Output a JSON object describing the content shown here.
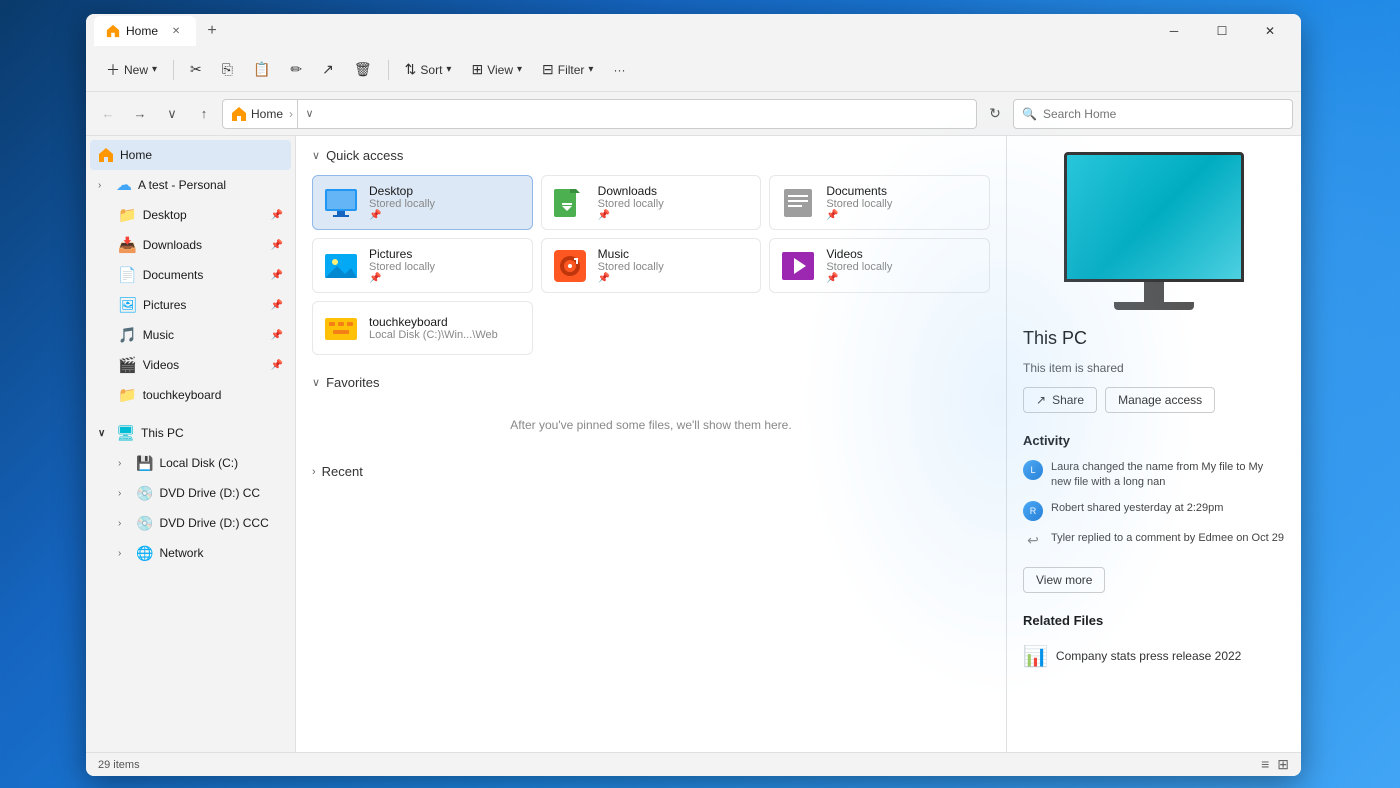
{
  "window": {
    "title": "Home",
    "tab_label": "Home",
    "new_tab_label": "+"
  },
  "window_controls": {
    "minimize": "─",
    "maximize": "☐",
    "close": "✕"
  },
  "toolbar": {
    "new_label": "New",
    "new_arrow": "▾",
    "sort_label": "Sort",
    "sort_arrow": "▾",
    "view_label": "View",
    "view_arrow": "▾",
    "filter_label": "Filter",
    "filter_arrow": "▾",
    "more_label": "···"
  },
  "address_bar": {
    "back_icon": "←",
    "forward_icon": "→",
    "recent_icon": "∨",
    "up_icon": "↑",
    "home_breadcrumb": "Home",
    "home_sep": "›",
    "chevron_icon": "∨",
    "refresh_icon": "↻",
    "search_placeholder": "Search Home"
  },
  "sidebar": {
    "home_label": "Home",
    "a_test_label": "A test - Personal",
    "pinned_items": [
      {
        "label": "Desktop",
        "pinned": true
      },
      {
        "label": "Downloads",
        "pinned": true
      },
      {
        "label": "Documents",
        "pinned": true
      },
      {
        "label": "Pictures",
        "pinned": true
      },
      {
        "label": "Music",
        "pinned": true
      },
      {
        "label": "Videos",
        "pinned": true
      },
      {
        "label": "touchkeyboard",
        "pinned": false
      }
    ],
    "this_pc_label": "This PC",
    "this_pc_items": [
      {
        "label": "Local Disk (C:)"
      },
      {
        "label": "DVD Drive (D:) CC"
      },
      {
        "label": "DVD Drive (D:) CCC"
      },
      {
        "label": "Network"
      }
    ]
  },
  "quick_access": {
    "section_label": "Quick access",
    "items": [
      {
        "name": "Desktop",
        "subtitle": "Stored locally",
        "pinned": true
      },
      {
        "name": "Downloads",
        "subtitle": "Stored locally",
        "pinned": true
      },
      {
        "name": "Documents",
        "subtitle": "Stored locally",
        "pinned": true
      },
      {
        "name": "Pictures",
        "subtitle": "Stored locally",
        "pinned": true
      },
      {
        "name": "Music",
        "subtitle": "Stored locally",
        "pinned": true
      },
      {
        "name": "Videos",
        "subtitle": "Stored locally",
        "pinned": true
      },
      {
        "name": "touchkeyboard",
        "subtitle": "Local Disk (C:)\\Win...\\Web",
        "pinned": false
      }
    ]
  },
  "favorites": {
    "section_label": "Favorites",
    "empty_message": "After you've pinned some files, we'll show them here."
  },
  "recent": {
    "section_label": "Recent"
  },
  "right_panel": {
    "pc_title": "This PC",
    "shared_label": "This item is shared",
    "share_btn": "Share",
    "manage_access_btn": "Manage access",
    "activity_title": "Activity",
    "activity_items": [
      {
        "text": "Laura changed the name from My file to My new file with a long nan",
        "type": "user"
      },
      {
        "text": "Robert shared yesterday at 2:29pm",
        "type": "user"
      },
      {
        "text": "Tyler replied to a comment by Edmee on Oct 29",
        "type": "reply"
      }
    ],
    "view_more_btn": "View more",
    "related_title": "Related Files",
    "related_items": [
      {
        "name": "Company stats press release 2022"
      }
    ]
  },
  "status_bar": {
    "items_count": "29 items"
  }
}
